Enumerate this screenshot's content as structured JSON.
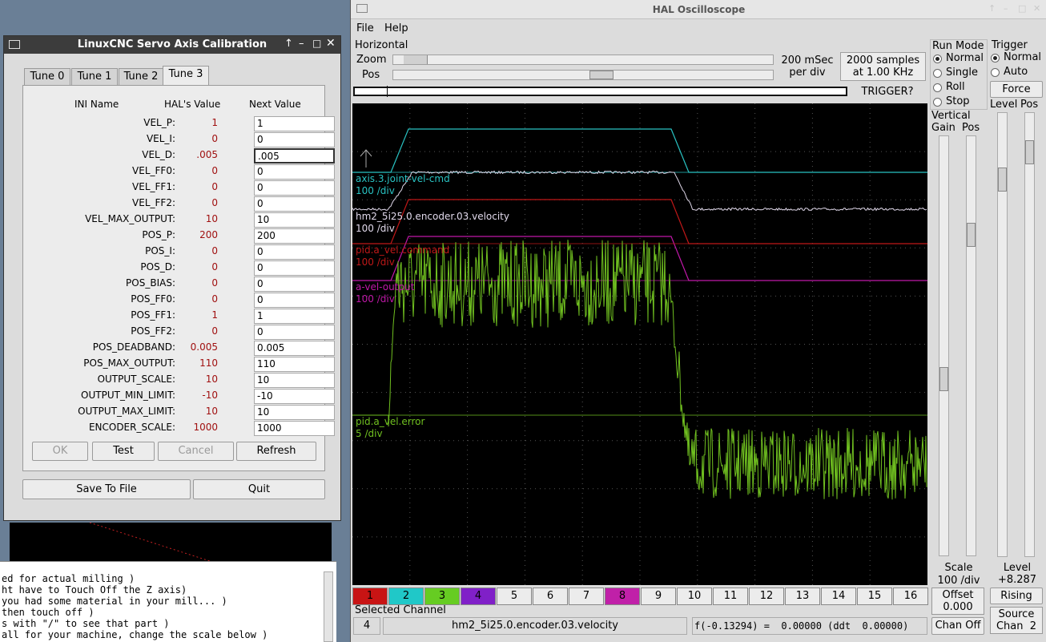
{
  "terminal": {
    "lines": [
      "ed for actual milling )",
      "ht have to Touch Off the Z axis)",
      "you had some material in your mill... )",
      "then touch off )",
      "s with \"/\" to see that part )",
      "all for your machine, change the scale below )"
    ]
  },
  "calibration": {
    "title": "LinuxCNC Servo Axis Calibration",
    "tabs": [
      "Tune 0",
      "Tune 1",
      "Tune 2",
      "Tune 3"
    ],
    "active_tab": "Tune 3",
    "headers": {
      "ini": "INI Name",
      "hal": "HAL's Value",
      "next": "Next Value"
    },
    "rows": [
      {
        "name": "VEL_P:",
        "hal": "1",
        "next": "1"
      },
      {
        "name": "VEL_I:",
        "hal": "0",
        "next": "0"
      },
      {
        "name": "VEL_D:",
        "hal": ".005",
        "next": ".005"
      },
      {
        "name": "VEL_FF0:",
        "hal": "0",
        "next": "0"
      },
      {
        "name": "VEL_FF1:",
        "hal": "0",
        "next": "0"
      },
      {
        "name": "VEL_FF2:",
        "hal": "0",
        "next": "0"
      },
      {
        "name": "VEL_MAX_OUTPUT:",
        "hal": "10",
        "next": "10"
      },
      {
        "name": "POS_P:",
        "hal": "200",
        "next": "200"
      },
      {
        "name": "POS_I:",
        "hal": "0",
        "next": "0"
      },
      {
        "name": "POS_D:",
        "hal": "0",
        "next": "0"
      },
      {
        "name": "POS_BIAS:",
        "hal": "0",
        "next": "0"
      },
      {
        "name": "POS_FF0:",
        "hal": "0",
        "next": "0"
      },
      {
        "name": "POS_FF1:",
        "hal": "1",
        "next": "1"
      },
      {
        "name": "POS_FF2:",
        "hal": "0",
        "next": "0"
      },
      {
        "name": "POS_DEADBAND:",
        "hal": "0.005",
        "next": "0.005"
      },
      {
        "name": "POS_MAX_OUTPUT:",
        "hal": "110",
        "next": "110"
      },
      {
        "name": "OUTPUT_SCALE:",
        "hal": "10",
        "next": "10"
      },
      {
        "name": "OUTPUT_MIN_LIMIT:",
        "hal": "-10",
        "next": "-10"
      },
      {
        "name": "OUTPUT_MAX_LIMIT:",
        "hal": "10",
        "next": "10"
      },
      {
        "name": "ENCODER_SCALE:",
        "hal": "1000",
        "next": "1000"
      }
    ],
    "buttons": {
      "ok": "OK",
      "test": "Test",
      "cancel": "Cancel",
      "refresh": "Refresh",
      "save": "Save To File",
      "quit": "Quit"
    }
  },
  "scope": {
    "title": "HAL Oscilloscope",
    "menu": [
      "File",
      "Help"
    ],
    "horizontal": {
      "label": "Horizontal",
      "zoom_label": "Zoom",
      "pos_label": "Pos",
      "timebase_line1": "200 mSec",
      "timebase_line2": "per div",
      "samples_line1": "2000 samples",
      "samples_line2": "at 1.00 KHz",
      "zoom_fraction": 0.03,
      "pos_fraction": 0.55
    },
    "trigger_status": "TRIGGER?",
    "run_mode": {
      "label": "Run Mode",
      "options": [
        "Normal",
        "Single",
        "Roll",
        "Stop"
      ],
      "selected": "Normal"
    },
    "trigger": {
      "label": "Trigger",
      "options": [
        "Normal",
        "Auto"
      ],
      "selected": "Normal",
      "force": "Force",
      "level_label": "Level",
      "pos_label": "Pos",
      "level_text_label": "Level",
      "level_value": "+8.287",
      "edge": "Rising",
      "source_line1": "Source",
      "source_line2": "Chan  2"
    },
    "vertical": {
      "label": "Vertical",
      "gain_label": "Gain",
      "pos_label": "Pos",
      "scale_label": "Scale",
      "scale_value": "100 /div",
      "offset_label": "Offset",
      "offset_value": "0.000",
      "chan_off": "Chan Off"
    },
    "traces": [
      {
        "name": "axis.3.joint-vel-cmd",
        "scale": "100 /div",
        "color": "#29c3c3"
      },
      {
        "name": "hm2_5i25.0.encoder.03.velocity",
        "scale": "100 /div",
        "color": "#e0d8ea"
      },
      {
        "name": "pid.a_vel.command",
        "scale": "100 /div",
        "color": "#c01818"
      },
      {
        "name": "a-vel-output",
        "scale": "100 /div",
        "color": "#c018a8"
      },
      {
        "name": "pid.a_vel.error",
        "scale": "5 /div",
        "color": "#70c020"
      }
    ],
    "channels": [
      {
        "label": "1",
        "color": "#c81414"
      },
      {
        "label": "2",
        "color": "#20c8c8"
      },
      {
        "label": "3",
        "color": "#66cc22"
      },
      {
        "label": "4",
        "color": "#8020c8"
      },
      {
        "label": "5",
        "color": ""
      },
      {
        "label": "6",
        "color": ""
      },
      {
        "label": "7",
        "color": ""
      },
      {
        "label": "8",
        "color": "#c020a8"
      },
      {
        "label": "9",
        "color": ""
      },
      {
        "label": "10",
        "color": ""
      },
      {
        "label": "11",
        "color": ""
      },
      {
        "label": "12",
        "color": ""
      },
      {
        "label": "13",
        "color": ""
      },
      {
        "label": "14",
        "color": ""
      },
      {
        "label": "15",
        "color": ""
      },
      {
        "label": "16",
        "color": ""
      }
    ],
    "selected_channel": {
      "label": "Selected Channel",
      "number": "4",
      "name": "hm2_5i25.0.encoder.03.velocity",
      "readout": "f(-0.13294) =  0.00000 (ddt  0.00000)"
    }
  }
}
